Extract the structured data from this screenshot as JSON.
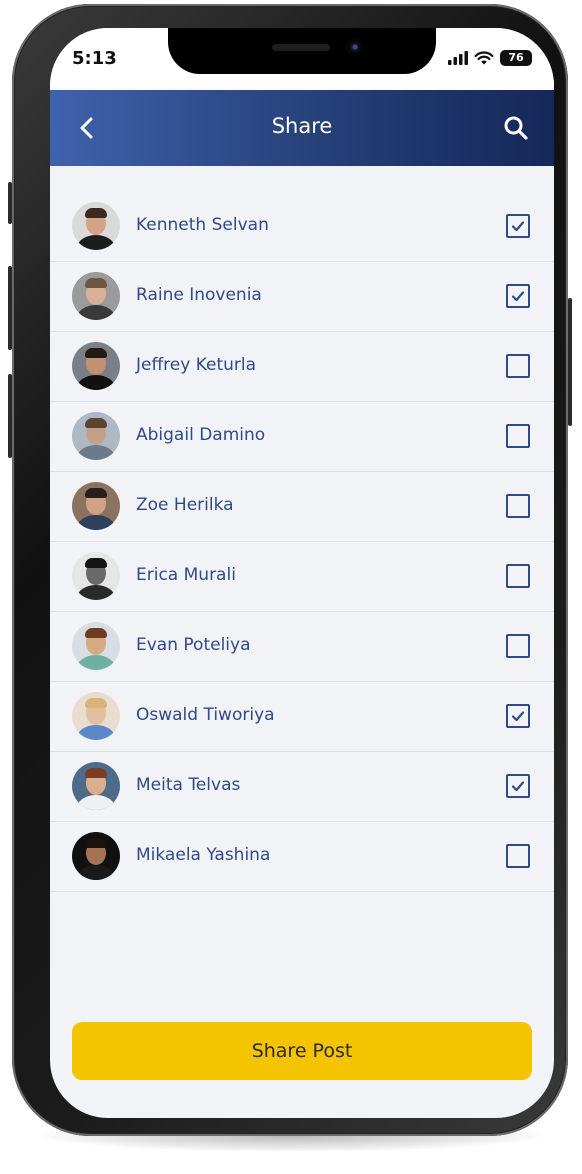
{
  "status_bar": {
    "time": "5:13",
    "battery": "76",
    "icons": [
      "signal-icon",
      "wifi-icon",
      "battery-icon"
    ]
  },
  "header": {
    "title": "Share",
    "back_icon": "chevron-left-icon",
    "search_icon": "search-icon"
  },
  "contacts": [
    {
      "name": "Kenneth Selvan",
      "checked": true,
      "avatar_bg": "#d9d9d9",
      "skin": "#d4a387",
      "hair": "#3b2a21",
      "shirt": "#1d1d1d"
    },
    {
      "name": "Raine Inovenia",
      "checked": true,
      "avatar_bg": "#9b9b9b",
      "skin": "#d9b19a",
      "hair": "#6e5640",
      "shirt": "#3a3a3a"
    },
    {
      "name": "Jeffrey Keturla",
      "checked": false,
      "avatar_bg": "#7b7f86",
      "skin": "#c39074",
      "hair": "#231a14",
      "shirt": "#111111"
    },
    {
      "name": "Abigail Damino",
      "checked": false,
      "avatar_bg": "#aeb9c4",
      "skin": "#c4a08a",
      "hair": "#5a4432",
      "shirt": "#6c7a8a"
    },
    {
      "name": "Zoe Herilka",
      "checked": false,
      "avatar_bg": "#8c7360",
      "skin": "#d0a387",
      "hair": "#2a1f18",
      "shirt": "#2d3f5a"
    },
    {
      "name": "Erica Murali",
      "checked": false,
      "avatar_bg": "#e6e6e6",
      "skin": "#6a6a6a",
      "hair": "#141414",
      "shirt": "#2a2a2a"
    },
    {
      "name": "Evan Poteliya",
      "checked": false,
      "avatar_bg": "#d7dde2",
      "skin": "#d7a983",
      "hair": "#6b3e24",
      "shirt": "#6fb0a0"
    },
    {
      "name": "Oswald Tiworiya",
      "checked": true,
      "avatar_bg": "#e9ddd0",
      "skin": "#e3bea0",
      "hair": "#d9b47a",
      "shirt": "#5b89c7"
    },
    {
      "name": "Meita Telvas",
      "checked": true,
      "avatar_bg": "#4d6b8a",
      "skin": "#dcae90",
      "hair": "#7a3f22",
      "shirt": "#f0f0f0"
    },
    {
      "name": "Mikaela Yashina",
      "checked": false,
      "avatar_bg": "#101010",
      "skin": "#a57454",
      "hair": "#1a1310",
      "shirt": "#1a1a1a"
    }
  ],
  "cta": {
    "label": "Share Post"
  },
  "colors": {
    "header_start": "#3f62ad",
    "header_end": "#142759",
    "accent_text": "#2f4a8a",
    "cta_bg": "#f5c400",
    "background": "#f2f3f6"
  }
}
